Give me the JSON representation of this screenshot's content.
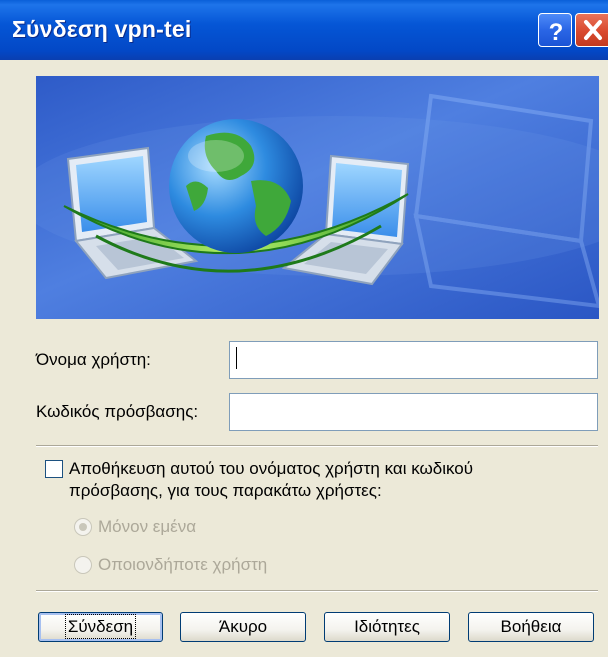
{
  "window": {
    "title": "Σύνδεση vpn-tei",
    "help_icon": "question-mark-icon",
    "close_icon": "close-x-icon"
  },
  "banner": {
    "description_icons": [
      "laptop-icon",
      "globe-icon",
      "laptop-icon"
    ]
  },
  "form": {
    "username_label": "Όνομα χρήστη:",
    "username_value": "",
    "password_label": "Κωδικός πρόσβασης:",
    "password_value": ""
  },
  "save_credentials": {
    "checkbox_checked": false,
    "label_line1": "Αποθήκευση αυτού του ονόματος χρήστη και κωδικού",
    "label_line2": "πρόσβασης, για τους παρακάτω χρήστες:",
    "options": [
      {
        "label": "Μόνον εμένα",
        "selected": true,
        "enabled": false
      },
      {
        "label": "Οποιονδήποτε χρήστη",
        "selected": false,
        "enabled": false
      }
    ]
  },
  "buttons": {
    "connect": "Σύνδεση",
    "cancel": "Άκυρο",
    "properties": "Ιδιότητες",
    "help": "Βοήθεια"
  },
  "colors": {
    "titlebar": "#0556D6",
    "dialog_bg": "#ECE9D8",
    "close_button": "#D9492E",
    "disabled_text": "#ACA899"
  }
}
